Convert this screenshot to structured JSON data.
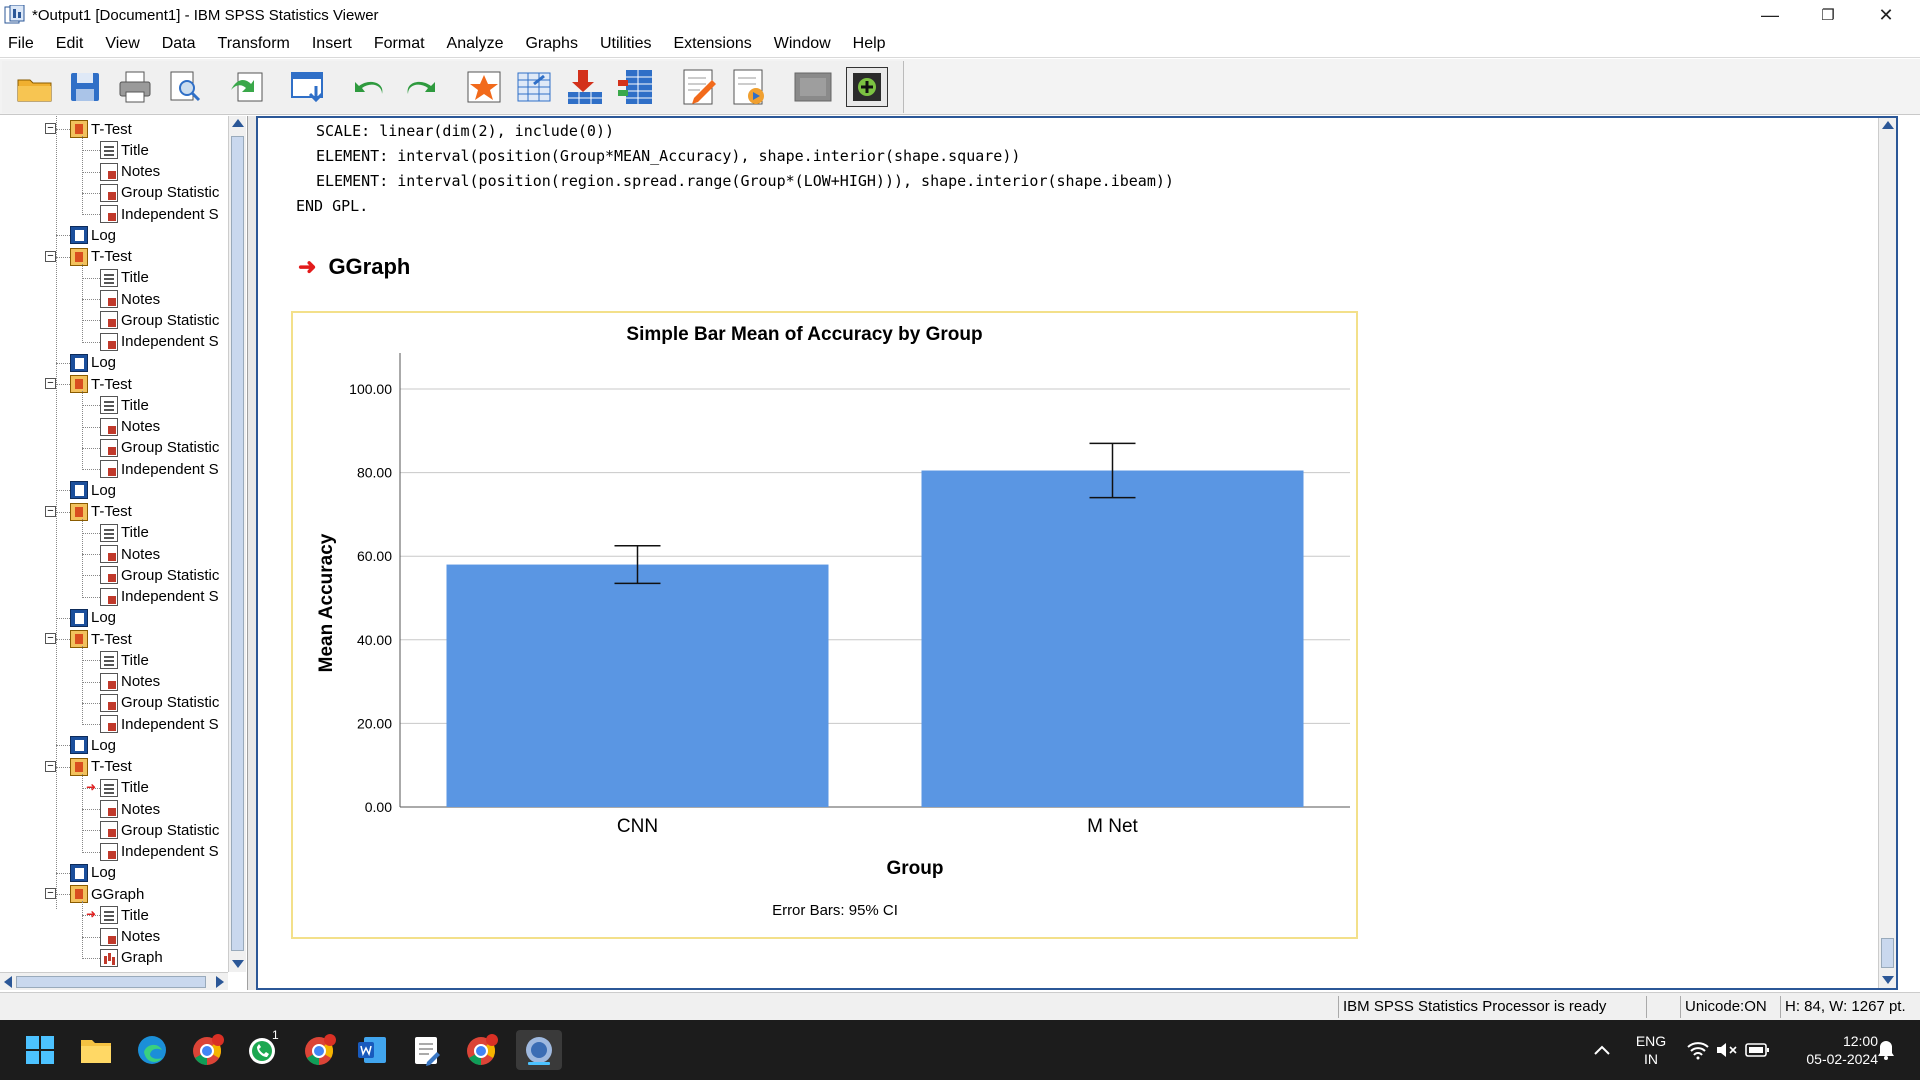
{
  "window": {
    "title": "*Output1 [Document1] - IBM SPSS Statistics Viewer",
    "minimize": "—",
    "maximize": "❐",
    "close": "✕"
  },
  "menu": [
    "File",
    "Edit",
    "View",
    "Data",
    "Transform",
    "Insert",
    "Format",
    "Analyze",
    "Graphs",
    "Utilities",
    "Extensions",
    "Window",
    "Help"
  ],
  "toolbar": {
    "icons": [
      "open-icon",
      "save-icon",
      "print-icon",
      "print-preview-icon",
      "export-icon",
      "go-to-data-icon",
      "undo-icon",
      "redo-icon",
      "designate-window-icon",
      "go-to-case-icon",
      "insert-output-icon",
      "variables-icon",
      "show-all-icon",
      "edit-icon",
      "script-icon",
      "stop-icon",
      "insert-text-icon"
    ]
  },
  "outline": {
    "groups": [
      {
        "title": "T-Test",
        "children": [
          "Title",
          "Notes",
          "Group Statistic",
          "Independent S"
        ]
      },
      {
        "title": "T-Test",
        "children": [
          "Title",
          "Notes",
          "Group Statistic",
          "Independent S"
        ]
      },
      {
        "title": "T-Test",
        "children": [
          "Title",
          "Notes",
          "Group Statistic",
          "Independent S"
        ]
      },
      {
        "title": "T-Test",
        "children": [
          "Title",
          "Notes",
          "Group Statistic",
          "Independent S"
        ]
      },
      {
        "title": "T-Test",
        "children": [
          "Title",
          "Notes",
          "Group Statistic",
          "Independent S"
        ]
      },
      {
        "title": "T-Test",
        "children": [
          "Title",
          "Notes",
          "Group Statistic",
          "Independent S"
        ]
      },
      {
        "title": "GGraph",
        "children": [
          "Title",
          "Notes",
          "Graph"
        ]
      }
    ],
    "log_label": "Log"
  },
  "syntax_lines": [
    "SCALE: linear(dim(2), include(0))",
    "ELEMENT: interval(position(Group*MEAN_Accuracy), shape.interior(shape.square))",
    "ELEMENT: interval(position(region.spread.range(Group*(LOW+HIGH))), shape.interior(shape.ibeam))",
    "END GPL."
  ],
  "section_heading": "GGraph",
  "chart_data": {
    "type": "bar",
    "title": "Simple Bar Mean of Accuracy by Group",
    "xlabel": "Group",
    "ylabel": "Mean Accuracy",
    "categories": [
      "CNN",
      "M Net"
    ],
    "values": [
      58.0,
      80.5
    ],
    "error_low": [
      53.5,
      74.0
    ],
    "error_high": [
      62.5,
      87.0
    ],
    "ylim": [
      0,
      100
    ],
    "yticks": [
      "0.00",
      "20.00",
      "40.00",
      "60.00",
      "80.00",
      "100.00"
    ],
    "ytick_values": [
      0,
      20,
      40,
      60,
      80,
      100
    ],
    "grid": true,
    "footnote": "Error Bars: 95% CI",
    "bar_color": "#5a96e3"
  },
  "status": {
    "processor": "IBM SPSS Statistics Processor is ready",
    "unicode": "Unicode:ON",
    "dims": "H: 84, W: 1267 pt."
  },
  "taskbar": {
    "lang_top": "ENG",
    "lang_bottom": "IN",
    "time": "12:00",
    "date": "05-02-2024",
    "whatsapp_badge": "1"
  }
}
